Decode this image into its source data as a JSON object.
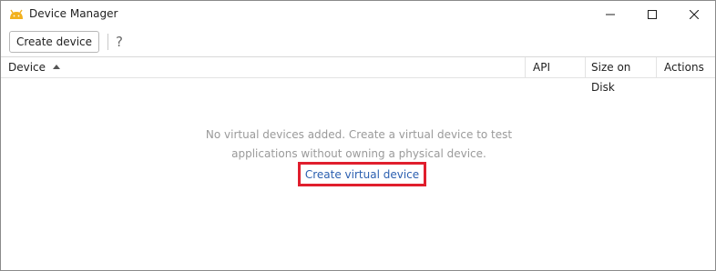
{
  "window": {
    "title": "Device Manager",
    "icon": "android-icon",
    "controls": [
      "minimize-icon",
      "maximize-icon",
      "close-icon"
    ]
  },
  "toolbar": {
    "create_label": "Create device",
    "help_label": "?"
  },
  "table": {
    "columns": [
      "Device",
      "API",
      "Size on Disk",
      "Actions"
    ],
    "sort_column": "Device",
    "sort_direction": "ascending"
  },
  "empty_state": {
    "line1": "No virtual devices added. Create a virtual device to test",
    "line2": "applications without owning a physical device.",
    "link_label": "Create virtual device",
    "link_color": "#2b5fb0",
    "highlight_color": "#e01e2d"
  }
}
